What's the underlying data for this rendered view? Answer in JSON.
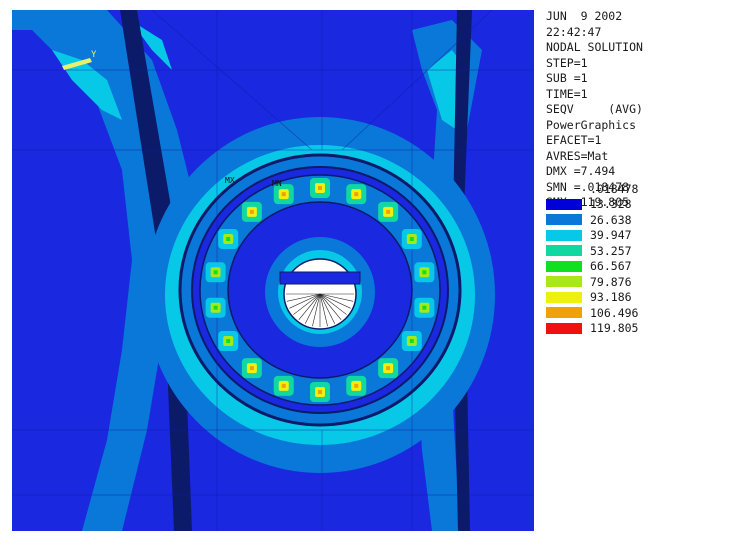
{
  "header": {
    "date": "JUN  9 2002",
    "time": "22:42:47",
    "solution_type": "NODAL SOLUTION",
    "step": "STEP=1",
    "sub": "SUB =1",
    "time_value": "TIME=1",
    "quantity": "SEQV     (AVG)",
    "graphics_mode": "PowerGraphics",
    "efacet": "EFACET=1",
    "avres": "AVRES=Mat",
    "dmx": "DMX =7.494",
    "smn": "SMN =.018478",
    "smx": "SMX =119.805"
  },
  "plot_labels": {
    "axis_y": "Y",
    "mx_marker": "MX",
    "mn_marker": "MN"
  },
  "legend": {
    "min_label": ".018478",
    "entries": [
      {
        "label": "13.328",
        "color": "#0000d8"
      },
      {
        "label": "26.638",
        "color": "#0a78d8"
      },
      {
        "label": "39.947",
        "color": "#08c8e8"
      },
      {
        "label": "53.257",
        "color": "#10d8a0"
      },
      {
        "label": "66.567",
        "color": "#10e020"
      },
      {
        "label": "79.876",
        "color": "#a8e818"
      },
      {
        "label": "93.186",
        "color": "#f0f010"
      },
      {
        "label": "106.496",
        "color": "#f0a008"
      },
      {
        "label": "119.805",
        "color": "#f01010"
      }
    ]
  }
}
